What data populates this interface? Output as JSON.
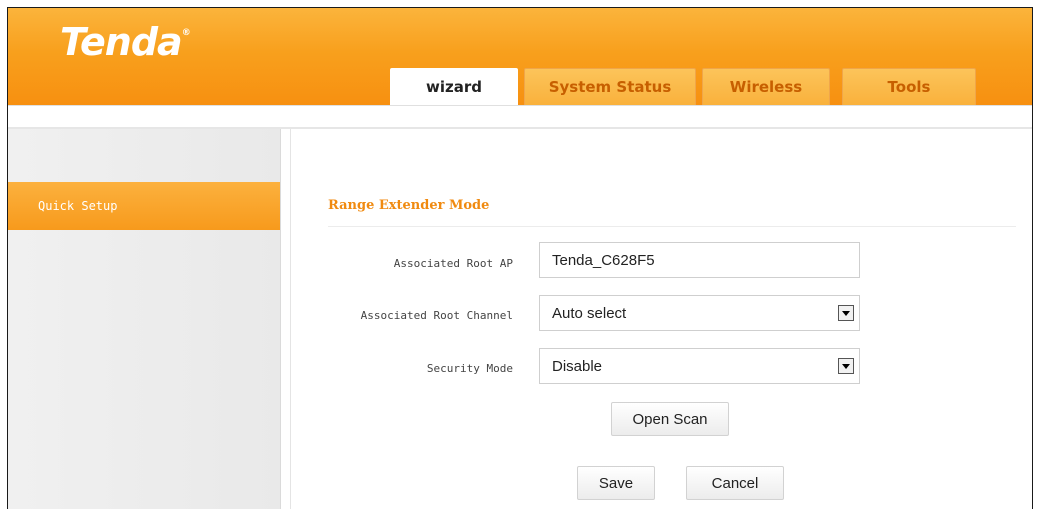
{
  "brand": {
    "logo_text": "Tenda",
    "logo_mark": "®"
  },
  "tabs": [
    {
      "label": "wizard",
      "active": true
    },
    {
      "label": "System Status",
      "active": false
    },
    {
      "label": "Wireless",
      "active": false
    },
    {
      "label": "Tools",
      "active": false
    }
  ],
  "sidebar": {
    "items": [
      {
        "label": "Quick Setup",
        "active": true
      }
    ]
  },
  "main": {
    "section_title": "Range Extender Mode",
    "fields": {
      "root_ap": {
        "label": "Associated Root AP",
        "value": "Tenda_C628F5"
      },
      "root_channel": {
        "label": "Associated Root Channel",
        "value": "Auto select"
      },
      "security_mode": {
        "label": "Security Mode",
        "value": "Disable"
      }
    },
    "buttons": {
      "open_scan": "Open Scan",
      "save": "Save",
      "cancel": "Cancel"
    }
  },
  "colors": {
    "brand_orange": "#f79a1c",
    "title_orange": "#f08a10",
    "tab_inactive_text": "#c75f00"
  },
  "icons": {
    "dropdown": "chevron-down-icon"
  }
}
